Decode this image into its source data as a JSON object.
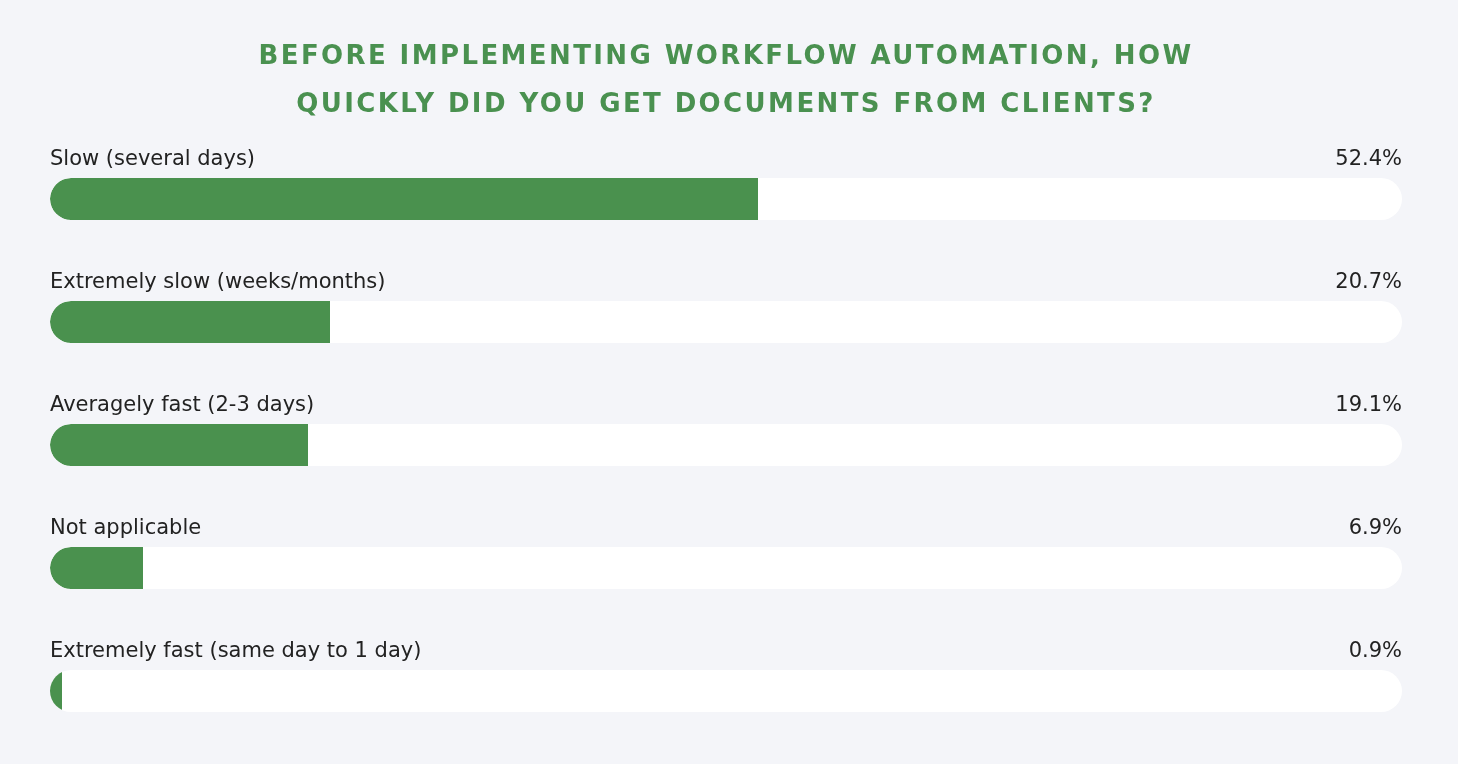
{
  "title": "BEFORE IMPLEMENTING WORKFLOW AUTOMATION, HOW QUICKLY DID YOU GET DOCUMENTS FROM CLIENTS?",
  "rows": [
    {
      "label": "Slow (several days)",
      "reading": "52.4%",
      "level": 0.524
    },
    {
      "label": "Extremely slow (weeks/months)",
      "reading": "20.7%",
      "level": 0.207
    },
    {
      "label": "Averagely fast (2-3 days)",
      "reading": "19.1%",
      "level": 0.191
    },
    {
      "label": "Not applicable",
      "reading": "6.9%",
      "level": 0.069
    },
    {
      "label": "Extremely fast (same day to 1 day)",
      "reading": "0.9%",
      "level": 0.009
    }
  ]
}
